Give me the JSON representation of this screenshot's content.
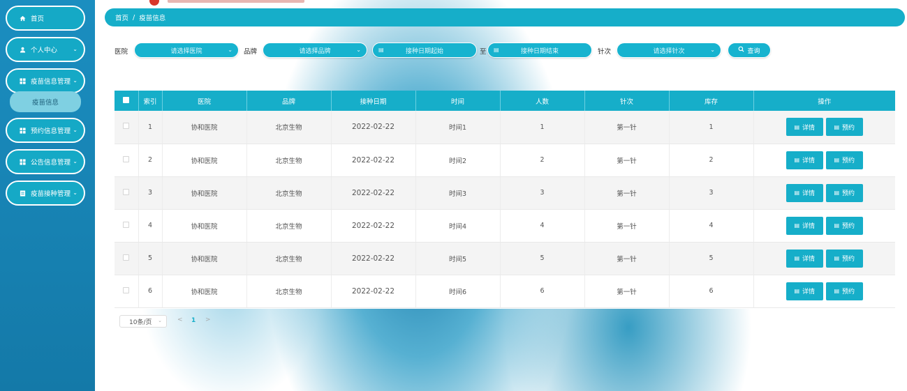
{
  "sidebar": {
    "items": [
      {
        "label": "首页",
        "icon": "home-icon"
      },
      {
        "label": "个人中心",
        "icon": "user-icon"
      },
      {
        "label": "疫苗信息管理",
        "icon": "grid-icon"
      },
      {
        "label": "预约信息管理",
        "icon": "grid-icon"
      },
      {
        "label": "公告信息管理",
        "icon": "grid-icon"
      },
      {
        "label": "疫苗接种管理",
        "icon": "doc-icon"
      }
    ],
    "sub_item": "疫苗信息"
  },
  "breadcrumb": {
    "home": "首页",
    "separator": "/",
    "current": "疫苗信息"
  },
  "filters": {
    "hospital_label": "医院",
    "hospital_placeholder": "请选择医院",
    "brand_label": "品牌",
    "brand_placeholder": "请选择品牌",
    "date_start_placeholder": "接种日期起始",
    "date_to": "至",
    "date_end_placeholder": "接种日期结束",
    "dose_label": "针次",
    "dose_placeholder": "请选择针次",
    "query_label": "查询"
  },
  "table": {
    "headers": [
      "索引",
      "医院",
      "品牌",
      "接种日期",
      "时间",
      "人数",
      "针次",
      "库存",
      "操作"
    ],
    "rows": [
      {
        "index": "1",
        "hospital": "协和医院",
        "brand": "北京生物",
        "date": "2022-02-22",
        "time": "时间1",
        "people": "1",
        "dose": "第一针",
        "stock": "1"
      },
      {
        "index": "2",
        "hospital": "协和医院",
        "brand": "北京生物",
        "date": "2022-02-22",
        "time": "时间2",
        "people": "2",
        "dose": "第一针",
        "stock": "2"
      },
      {
        "index": "3",
        "hospital": "协和医院",
        "brand": "北京生物",
        "date": "2022-02-22",
        "time": "时间3",
        "people": "3",
        "dose": "第一针",
        "stock": "3"
      },
      {
        "index": "4",
        "hospital": "协和医院",
        "brand": "北京生物",
        "date": "2022-02-22",
        "time": "时间4",
        "people": "4",
        "dose": "第一针",
        "stock": "4"
      },
      {
        "index": "5",
        "hospital": "协和医院",
        "brand": "北京生物",
        "date": "2022-02-22",
        "time": "时间5",
        "people": "5",
        "dose": "第一针",
        "stock": "5"
      },
      {
        "index": "6",
        "hospital": "协和医院",
        "brand": "北京生物",
        "date": "2022-02-22",
        "time": "时间6",
        "people": "6",
        "dose": "第一针",
        "stock": "6"
      }
    ],
    "detail_label": "详情",
    "reserve_label": "预约"
  },
  "pagination": {
    "page_size": "10条/页",
    "current_page": "1",
    "prev": "<",
    "next": ">"
  },
  "colors": {
    "accent": "#16aec9",
    "sidebar": "#1b8ec0"
  }
}
